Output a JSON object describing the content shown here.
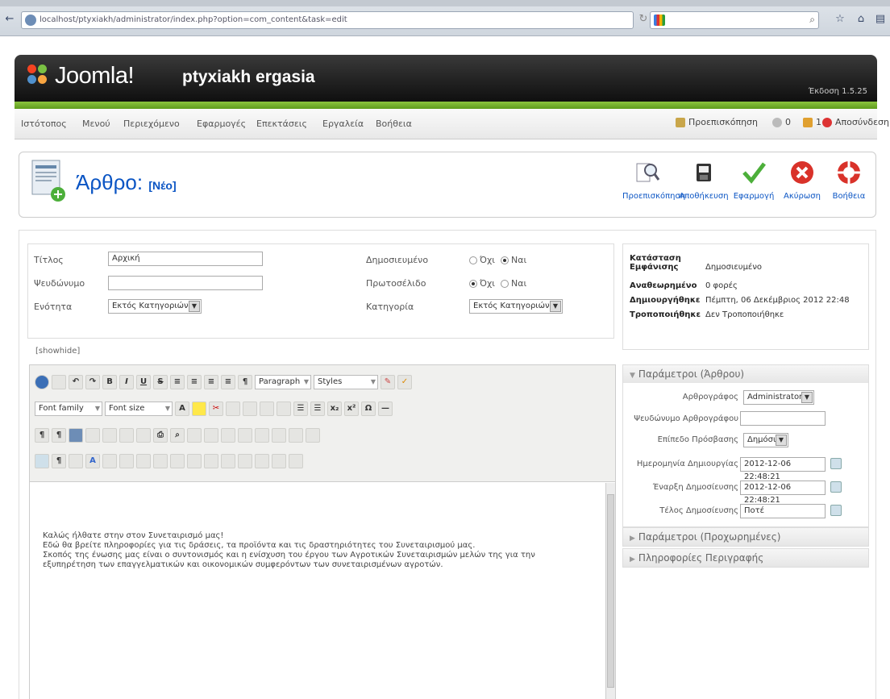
{
  "browser": {
    "url": "localhost/ptyxiakh/administrator/index.php?option=com_content&task=edit",
    "back_glyph": "←",
    "home_glyph": "⌂"
  },
  "header": {
    "logo_text": "Joomla!",
    "site_name": "ptyxiakh ergasia",
    "version": "Έκδοση 1.5.25"
  },
  "menu": {
    "items": [
      "Ιστότοπος",
      "Μενού",
      "Περιεχόμενο",
      "Εφαρμογές",
      "Επεκτάσεις",
      "Εργαλεία",
      "Βοήθεια"
    ],
    "preview": "Προεπισκόπηση",
    "messages_count": "0",
    "users_count": "1",
    "logout": "Αποσύνδεση"
  },
  "toolbar": {
    "title": "Άρθρο:",
    "title_state": "[Νέο]",
    "buttons": [
      "Προεπισκόπηση",
      "Αποθήκευση",
      "Εφαρμογή",
      "Ακύρωση",
      "Βοήθεια"
    ]
  },
  "form": {
    "title_label": "Τίτλος",
    "title_value": "Αρχική",
    "alias_label": "Ψευδώνυμο",
    "alias_value": "",
    "section_label": "Ενότητα",
    "section_value": "Εκτός Κατηγοριών",
    "published_label": "Δημοσιευμένο",
    "frontpage_label": "Πρωτοσέλιδο",
    "category_label": "Κατηγορία",
    "category_value": "Εκτός Κατηγοριών",
    "no": "Όχι",
    "yes": "Ναι"
  },
  "editor": {
    "label": "[showhide]",
    "format_select": "Paragraph",
    "styles_select": "Styles",
    "font_family": "Font family",
    "font_size": "Font size",
    "body_lines": [
      "Καλώς ήλθατε στην στον Συνεταιρισμό μας!",
      "Εδώ θα βρείτε πληροφορίες για τις δράσεις, τα προϊόντα και τις δραστηριότητες του Συνεταιρισμού μας.",
      "Σκοπός της ένωσης μας είναι ο συντονισμός και η ενίσχυση του έργου των Αγροτικών Συνεταιρισμών μελών της για την",
      "εξυπηρέτηση των επαγγελματικών και οικονομικών συμφερόντων των συνεταιρισμένων αγροτών."
    ]
  },
  "info": {
    "state_label": "Κατάσταση Εμφάνισης",
    "state_value": "Δημοσιευμένο",
    "hits_label": "Αναθεωρημένο",
    "hits_value": "0 φορές",
    "created_label": "Δημιουργήθηκε",
    "created_value": "Πέμπτη, 06 Δεκέμβριος 2012 22:48",
    "modified_label": "Τροποποιήθηκε",
    "modified_value": "Δεν Τροποποιήθηκε"
  },
  "params": {
    "heading": "Παράμετροι (Άρθρου)",
    "author_label": "Αρθρογράφος",
    "author_value": "Administrator",
    "alias_author_label": "Ψευδώνυμο Αρθρογράφου",
    "access_label": "Επίπεδο Πρόσβασης",
    "access_value": "Δημόσιο",
    "created_date_label": "Ημερομηνία Δημιουργίας",
    "created_date_value": "2012-12-06 22:48:21",
    "publish_up_label": "Έναρξη Δημοσίευσης",
    "publish_up_value": "2012-12-06 22:48:21",
    "publish_down_label": "Τέλος Δημοσίευσης",
    "publish_down_value": "Ποτέ",
    "advanced": "Παράμετροι (Προχωρημένες)",
    "metadata": "Πληροφορίες Περιγραφής"
  }
}
